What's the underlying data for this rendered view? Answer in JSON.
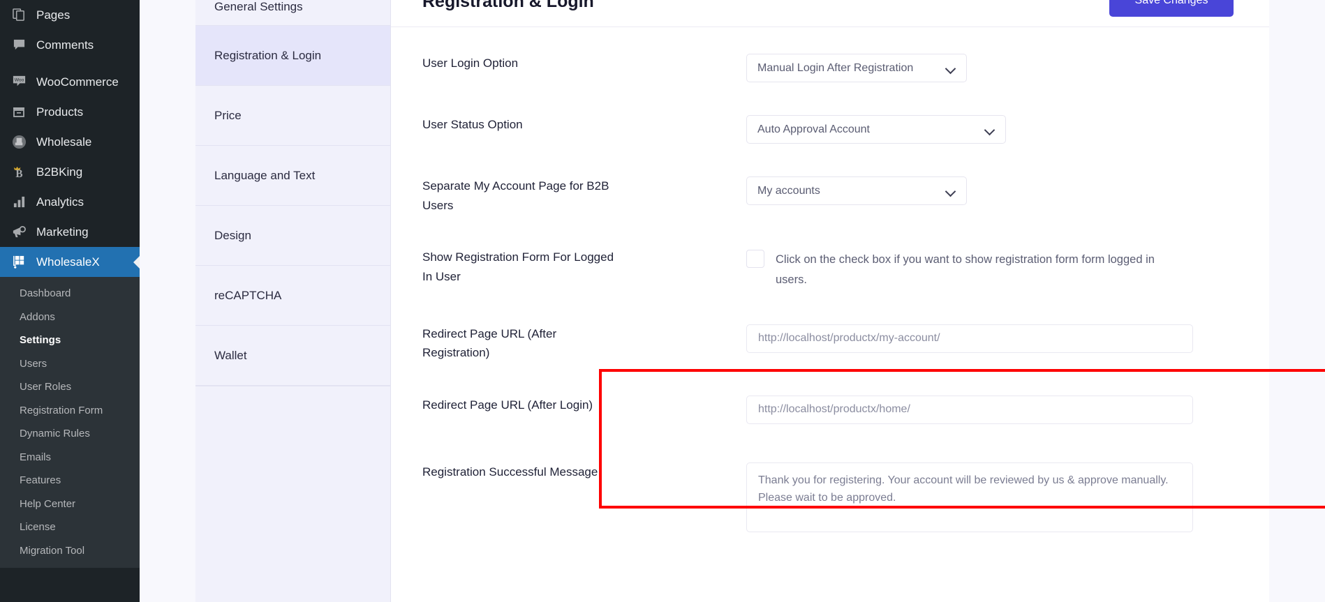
{
  "wp_sidebar": {
    "items": [
      {
        "label": "Pages",
        "icon": "pages-icon"
      },
      {
        "label": "Comments",
        "icon": "comments-icon"
      },
      {
        "label": "WooCommerce",
        "icon": "woocommerce-icon"
      },
      {
        "label": "Products",
        "icon": "products-icon"
      },
      {
        "label": "Wholesale",
        "icon": "wholesale-icon"
      },
      {
        "label": "B2BKing",
        "icon": "b2bking-icon"
      },
      {
        "label": "Analytics",
        "icon": "analytics-icon"
      },
      {
        "label": "Marketing",
        "icon": "marketing-icon"
      },
      {
        "label": "WholesaleX",
        "icon": "wholesalex-icon",
        "active": true
      }
    ],
    "submenu": [
      {
        "label": "Dashboard"
      },
      {
        "label": "Addons"
      },
      {
        "label": "Settings",
        "current": true
      },
      {
        "label": "Users"
      },
      {
        "label": "User Roles"
      },
      {
        "label": "Registration Form"
      },
      {
        "label": "Dynamic Rules"
      },
      {
        "label": "Emails"
      },
      {
        "label": "Features"
      },
      {
        "label": "Help Center"
      },
      {
        "label": "License"
      },
      {
        "label": "Migration Tool"
      }
    ],
    "active_color": "#2271b1",
    "background": "#1d2327"
  },
  "settings_nav": {
    "items": [
      {
        "label": "General Settings"
      },
      {
        "label": "Registration & Login",
        "active": true
      },
      {
        "label": "Price"
      },
      {
        "label": "Language and Text"
      },
      {
        "label": "Design"
      },
      {
        "label": "reCAPTCHA"
      },
      {
        "label": "Wallet"
      }
    ],
    "active_background": "#e5e5fa"
  },
  "header": {
    "title": "Registration & Login",
    "save_label": "Save Changes",
    "save_color": "#4945d8"
  },
  "form": {
    "user_login_option": {
      "label": "User Login Option",
      "value": "Manual Login After Registration"
    },
    "user_status_option": {
      "label": "User Status Option",
      "value": "Auto Approval Account"
    },
    "separate_my_account": {
      "label": "Separate My Account Page for B2B Users",
      "value": "My accounts"
    },
    "show_registration_form": {
      "label": "Show Registration Form For Logged In User",
      "description": "Click on the check box if you want to show registration form form logged in users.",
      "checked": false
    },
    "redirect_after_registration": {
      "label": "Redirect Page URL (After Registration)",
      "value": "http://localhost/productx/my-account/"
    },
    "redirect_after_login": {
      "label": "Redirect Page URL (After Login)",
      "value": "http://localhost/productx/home/"
    },
    "registration_successful_message": {
      "label": "Registration Successful Message",
      "value": "Thank you for registering. Your account will be reviewed by us & approve manually. Please wait to be approved."
    }
  },
  "annotation": {
    "highlight_color": "#fe0000"
  }
}
